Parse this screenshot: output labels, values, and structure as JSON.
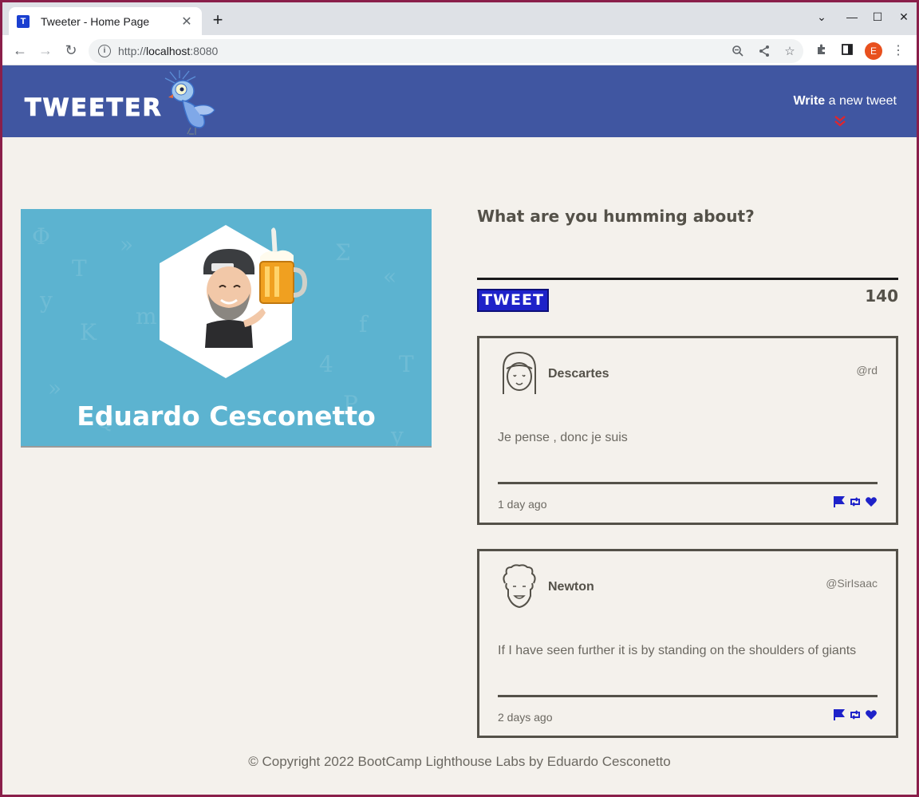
{
  "browser": {
    "tab_title": "Tweeter - Home Page",
    "tab_favicon_letter": "T",
    "url_prefix": "http://",
    "url_host": "localhost",
    "url_port": ":8080",
    "profile_initial": "E"
  },
  "nav": {
    "logo": "TWEETER",
    "compose_bold": "Write",
    "compose_rest": " a new tweet"
  },
  "profile": {
    "name": "Eduardo Cesconetto"
  },
  "composer": {
    "prompt": "What are you humming about?",
    "button_label": "TWEET",
    "counter": "140"
  },
  "tweets": [
    {
      "name": "Descartes",
      "handle": "@rd",
      "text": "Je pense , donc je suis",
      "time": "1 day ago"
    },
    {
      "name": "Newton",
      "handle": "@SirIsaac",
      "text": "If I have seen further it is by standing on the shoulders of giants",
      "time": "2 days ago"
    }
  ],
  "footer": {
    "text": "© Copyright 2022 BootCamp Lighthouse Labs by Eduardo Cesconetto"
  },
  "colors": {
    "nav_bg": "#4056a1",
    "page_bg": "#f4f1ec",
    "card_bg": "#5cb3d0",
    "accent": "#1e22c9",
    "arrow": "#e0262c"
  }
}
